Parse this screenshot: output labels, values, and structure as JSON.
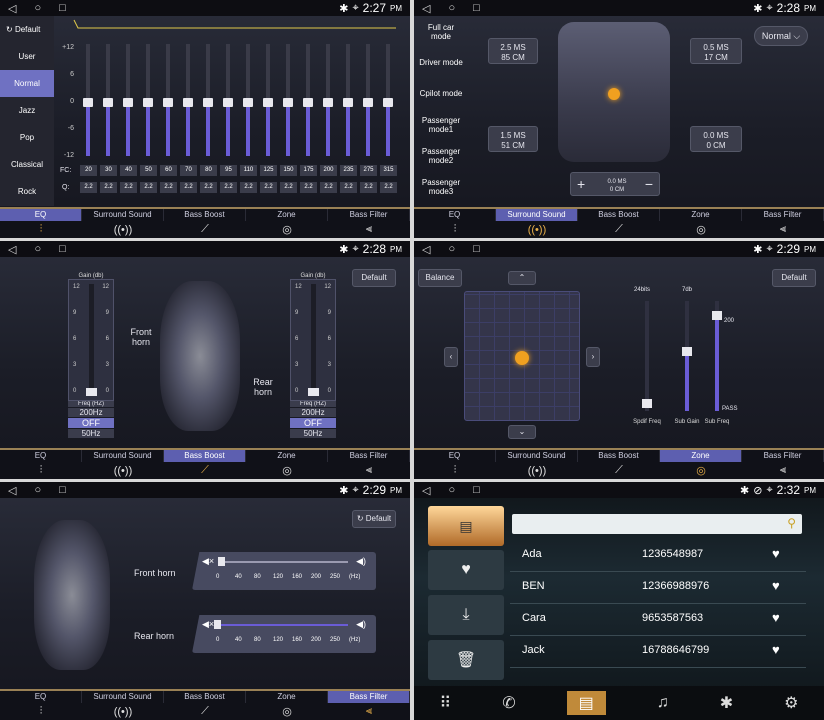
{
  "status": {
    "time1": "2:27",
    "time": "2:28",
    "time3": "2:29",
    "time6": "2:32",
    "pm": "PM"
  },
  "tabs": [
    "EQ",
    "Surround Sound",
    "Bass Boost",
    "Zone",
    "Bass Filter"
  ],
  "eq": {
    "default": "Default",
    "presets": [
      "User",
      "Normal",
      "Jazz",
      "Pop",
      "Classical",
      "Rock"
    ],
    "scale": [
      "+12",
      "6",
      "0",
      "-6",
      "-12"
    ],
    "fc_label": "FC:",
    "q_label": "Q:",
    "fc": [
      "20",
      "30",
      "40",
      "50",
      "60",
      "70",
      "80",
      "95",
      "110",
      "125",
      "150",
      "175",
      "200",
      "235",
      "275",
      "315"
    ],
    "q": [
      "2.2",
      "2.2",
      "2.2",
      "2.2",
      "2.2",
      "2.2",
      "2.2",
      "2.2",
      "2.2",
      "2.2",
      "2.2",
      "2.2",
      "2.2",
      "2.2",
      "2.2",
      "2.2"
    ]
  },
  "surround": {
    "modes": [
      "Full car mode",
      "Driver mode",
      "Cpilot mode",
      "Passenger mode1",
      "Passenger mode2",
      "Passenger mode3"
    ],
    "dropdown": "Normal",
    "fl": [
      "2.5 MS",
      "85 CM"
    ],
    "fr": [
      "0.5 MS",
      "17 CM"
    ],
    "rl": [
      "1.5 MS",
      "51 CM"
    ],
    "rr": [
      "0.0 MS",
      "0 CM"
    ],
    "center": [
      "0.0 MS",
      "0 CM"
    ],
    "plus": "+",
    "minus": "−"
  },
  "bass": {
    "default": "Default",
    "gain": "Gain (db)",
    "scale": [
      "12",
      "9",
      "6",
      "3",
      "0"
    ],
    "freq": "Freq (HZ)",
    "freq1": "200Hz",
    "state": "OFF",
    "freq2": "50Hz",
    "front": "Front horn",
    "rear": "Rear horn"
  },
  "zone": {
    "balance": "Balance",
    "default": "Default",
    "bits": "24bits",
    "db": "7db",
    "v200": "200",
    "pass": "PASS",
    "s1": "Spdif Freq",
    "s2": "Sub Gain",
    "s3": "Sub Freq"
  },
  "filter": {
    "default": "Default",
    "front": "Front horn",
    "rear": "Rear horn",
    "ticks": [
      "0",
      "40",
      "80",
      "120",
      "160",
      "200",
      "250",
      "(Hz)"
    ]
  },
  "contacts": [
    {
      "name": "Ada",
      "num": "1236548987"
    },
    {
      "name": "BEN",
      "num": "12366988976"
    },
    {
      "name": "Cara",
      "num": "9653587563"
    },
    {
      "name": "Jack",
      "num": "16788646799"
    }
  ],
  "colors": {
    "accent": "#5d5fb0",
    "gold": "#e9b04a"
  }
}
